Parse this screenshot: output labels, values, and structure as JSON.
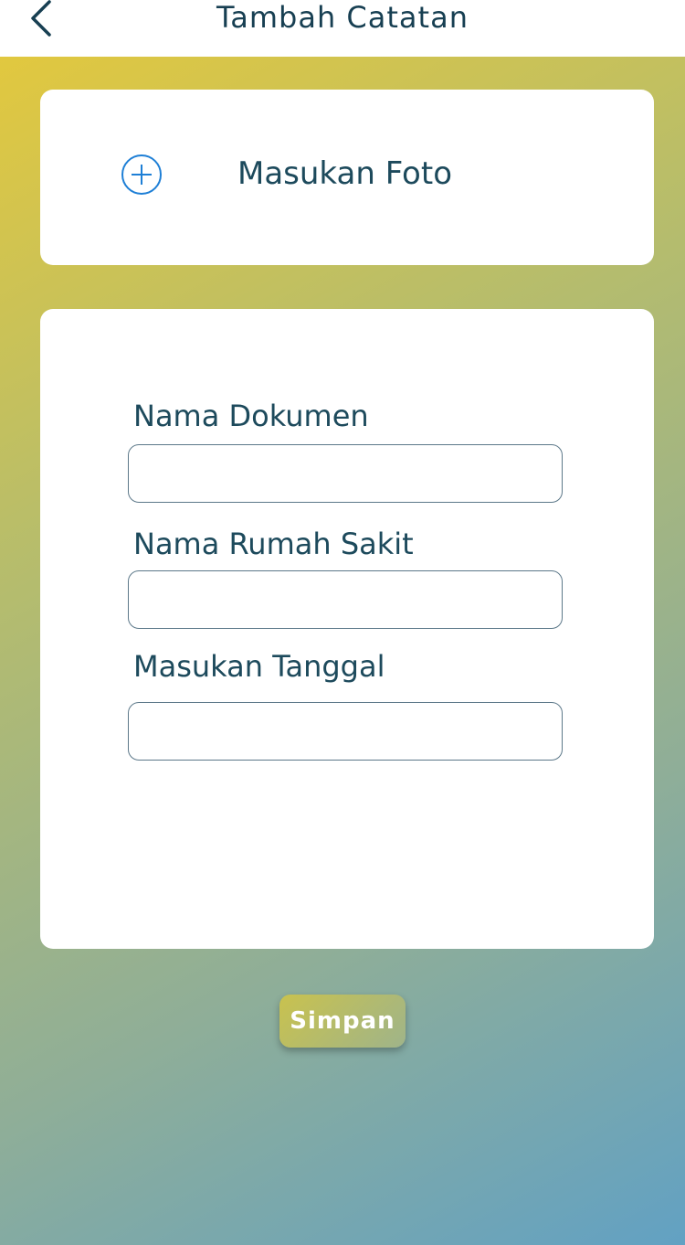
{
  "header": {
    "title": "Tambah Catatan",
    "back_icon": "chevron-left-icon"
  },
  "photo": {
    "label": "Masukan Foto",
    "icon": "plus-circle-icon",
    "icon_color": "#1e7fd6"
  },
  "form": {
    "fields": [
      {
        "label": "Nama Dokumen",
        "value": ""
      },
      {
        "label": "Nama Rumah Sakit",
        "value": ""
      },
      {
        "label": "Masukan Tanggal",
        "value": ""
      }
    ]
  },
  "actions": {
    "save_label": "Simpan"
  },
  "colors": {
    "text": "#1d4a5c",
    "gradient_start": "#e6c93a",
    "gradient_end": "#62a1c3"
  }
}
